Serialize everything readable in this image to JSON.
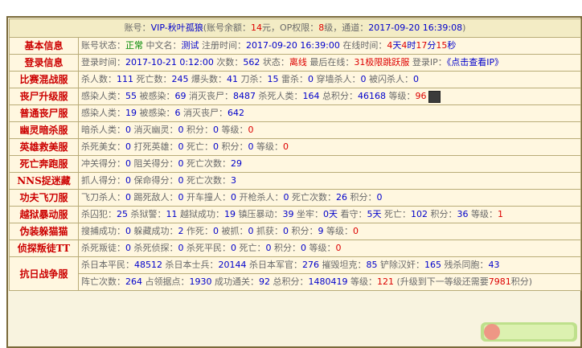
{
  "header": {
    "account_label": "账号：",
    "account_name": "VIP-秋叶孤狼",
    "balance_label": "(账号余额：",
    "balance_value": "14",
    "balance_unit": "元，OP权限：",
    "op_level": "8",
    "op_unit": "级，通道：",
    "channel_time": "2017-09-20 16:39:08",
    "close_paren": ")"
  },
  "rows": [
    {
      "label": "基本信息",
      "line": [
        {
          "t": "账号状态：",
          "c": "gray"
        },
        {
          "t": "正常",
          "c": "green"
        },
        {
          "t": " 中文名：",
          "c": "gray"
        },
        {
          "t": "测试",
          "c": "v"
        },
        {
          "t": " 注册时间：",
          "c": "gray"
        },
        {
          "t": "2017-09-20 16:39:00",
          "c": "v"
        },
        {
          "t": " 在线时间：",
          "c": "gray"
        },
        {
          "t": "4",
          "c": "red"
        },
        {
          "t": "天",
          "c": "v"
        },
        {
          "t": "4",
          "c": "red"
        },
        {
          "t": "时",
          "c": "v"
        },
        {
          "t": "17",
          "c": "red"
        },
        {
          "t": "分",
          "c": "v"
        },
        {
          "t": "15",
          "c": "red"
        },
        {
          "t": "秒",
          "c": "v"
        }
      ]
    },
    {
      "label": "登录信息",
      "line": [
        {
          "t": "登录时间：",
          "c": "gray"
        },
        {
          "t": "2017-10-21 0:12:00",
          "c": "v"
        },
        {
          "t": " 次数：",
          "c": "gray"
        },
        {
          "t": "562",
          "c": "v"
        },
        {
          "t": " 状态：",
          "c": "gray"
        },
        {
          "t": "离线",
          "c": "red"
        },
        {
          "t": " 最后在线：",
          "c": "gray"
        },
        {
          "t": "31极限跳跃服",
          "c": "red"
        },
        {
          "t": " 登录IP：",
          "c": "gray"
        },
        {
          "t": "《点击查看IP》",
          "c": "v"
        }
      ]
    },
    {
      "label": "比赛混战服",
      "line": [
        {
          "t": "杀人数：",
          "c": "gray"
        },
        {
          "t": "111",
          "c": "v"
        },
        {
          "t": " 死亡数：",
          "c": "gray"
        },
        {
          "t": "245",
          "c": "v"
        },
        {
          "t": " 爆头数：",
          "c": "gray"
        },
        {
          "t": "41",
          "c": "v"
        },
        {
          "t": " 刀杀：",
          "c": "gray"
        },
        {
          "t": "15",
          "c": "v"
        },
        {
          "t": " 雷杀：",
          "c": "gray"
        },
        {
          "t": "0",
          "c": "v"
        },
        {
          "t": " 穿墙杀人：",
          "c": "gray"
        },
        {
          "t": "0",
          "c": "v"
        },
        {
          "t": " 被闪杀人：",
          "c": "gray"
        },
        {
          "t": "0",
          "c": "v"
        }
      ]
    },
    {
      "label": "丧尸升级服",
      "avatar": true,
      "line": [
        {
          "t": "感染人类：",
          "c": "gray"
        },
        {
          "t": "55",
          "c": "v"
        },
        {
          "t": " 被感染：",
          "c": "gray"
        },
        {
          "t": "69",
          "c": "v"
        },
        {
          "t": " 消灭丧尸：",
          "c": "gray"
        },
        {
          "t": "8487",
          "c": "v"
        },
        {
          "t": " 杀死人类：",
          "c": "gray"
        },
        {
          "t": "164",
          "c": "v"
        },
        {
          "t": " 总积分：",
          "c": "gray"
        },
        {
          "t": "46168",
          "c": "v"
        },
        {
          "t": " 等级：",
          "c": "gray"
        },
        {
          "t": "96",
          "c": "red"
        }
      ]
    },
    {
      "label": "普通丧尸服",
      "line": [
        {
          "t": "感染人类：",
          "c": "gray"
        },
        {
          "t": "19",
          "c": "v"
        },
        {
          "t": " 被感染：",
          "c": "gray"
        },
        {
          "t": "6",
          "c": "v"
        },
        {
          "t": " 消灭丧尸：",
          "c": "gray"
        },
        {
          "t": "642",
          "c": "v"
        }
      ]
    },
    {
      "label": "幽灵暗杀服",
      "line": [
        {
          "t": "暗杀人类：",
          "c": "gray"
        },
        {
          "t": "0",
          "c": "v"
        },
        {
          "t": " 消灭幽灵：",
          "c": "gray"
        },
        {
          "t": "0",
          "c": "v"
        },
        {
          "t": " 积分：",
          "c": "gray"
        },
        {
          "t": "0",
          "c": "v"
        },
        {
          "t": " 等级：",
          "c": "gray"
        },
        {
          "t": "0",
          "c": "red"
        }
      ]
    },
    {
      "label": "英雄救美服",
      "line": [
        {
          "t": "杀死美女：",
          "c": "gray"
        },
        {
          "t": "0",
          "c": "v"
        },
        {
          "t": " 打死英雄：",
          "c": "gray"
        },
        {
          "t": "0",
          "c": "v"
        },
        {
          "t": " 死亡：",
          "c": "gray"
        },
        {
          "t": "0",
          "c": "v"
        },
        {
          "t": " 积分：",
          "c": "gray"
        },
        {
          "t": "0",
          "c": "v"
        },
        {
          "t": " 等级：",
          "c": "gray"
        },
        {
          "t": "0",
          "c": "red"
        }
      ]
    },
    {
      "label": "死亡奔跑服",
      "line": [
        {
          "t": "冲关得分：",
          "c": "gray"
        },
        {
          "t": "0",
          "c": "v"
        },
        {
          "t": " 阻关得分：",
          "c": "gray"
        },
        {
          "t": "0",
          "c": "v"
        },
        {
          "t": " 死亡次数：",
          "c": "gray"
        },
        {
          "t": "29",
          "c": "v"
        }
      ]
    },
    {
      "label": "NNS捉迷藏",
      "line": [
        {
          "t": "抓人得分：",
          "c": "gray"
        },
        {
          "t": "0",
          "c": "v"
        },
        {
          "t": " 保命得分：",
          "c": "gray"
        },
        {
          "t": "0",
          "c": "v"
        },
        {
          "t": " 死亡次数：",
          "c": "gray"
        },
        {
          "t": "3",
          "c": "v"
        }
      ]
    },
    {
      "label": "功夫飞刀服",
      "line": [
        {
          "t": "飞刀杀人：",
          "c": "gray"
        },
        {
          "t": "0",
          "c": "v"
        },
        {
          "t": " 踢死敌人：",
          "c": "gray"
        },
        {
          "t": "0",
          "c": "v"
        },
        {
          "t": " 开车撞人：",
          "c": "gray"
        },
        {
          "t": "0",
          "c": "v"
        },
        {
          "t": " 开枪杀人：",
          "c": "gray"
        },
        {
          "t": "0",
          "c": "v"
        },
        {
          "t": " 死亡次数：",
          "c": "gray"
        },
        {
          "t": "26",
          "c": "v"
        },
        {
          "t": " 积分：",
          "c": "gray"
        },
        {
          "t": "0",
          "c": "v"
        }
      ]
    },
    {
      "label": "越狱暴动服",
      "line": [
        {
          "t": "杀囚犯：",
          "c": "gray"
        },
        {
          "t": "25",
          "c": "v"
        },
        {
          "t": " 杀狱警：",
          "c": "gray"
        },
        {
          "t": "11",
          "c": "v"
        },
        {
          "t": " 越狱成功：",
          "c": "gray"
        },
        {
          "t": "19",
          "c": "v"
        },
        {
          "t": " 镇压暴动：",
          "c": "gray"
        },
        {
          "t": "39",
          "c": "v"
        },
        {
          "t": " 坐牢：",
          "c": "gray"
        },
        {
          "t": "0天",
          "c": "v"
        },
        {
          "t": " 看守：",
          "c": "gray"
        },
        {
          "t": "5天",
          "c": "v"
        },
        {
          "t": " 死亡：",
          "c": "gray"
        },
        {
          "t": "102",
          "c": "v"
        },
        {
          "t": " 积分：",
          "c": "gray"
        },
        {
          "t": "36",
          "c": "v"
        },
        {
          "t": " 等级：",
          "c": "gray"
        },
        {
          "t": "1",
          "c": "red"
        }
      ]
    },
    {
      "label": "伪装躲猫猫",
      "line": [
        {
          "t": "搜捕成功：",
          "c": "gray"
        },
        {
          "t": "0",
          "c": "v"
        },
        {
          "t": " 躲藏成功：",
          "c": "gray"
        },
        {
          "t": "2",
          "c": "v"
        },
        {
          "t": " 作死：",
          "c": "gray"
        },
        {
          "t": "0",
          "c": "v"
        },
        {
          "t": " 被抓：",
          "c": "gray"
        },
        {
          "t": "0",
          "c": "v"
        },
        {
          "t": " 抓获：",
          "c": "gray"
        },
        {
          "t": "0",
          "c": "v"
        },
        {
          "t": " 积分：",
          "c": "gray"
        },
        {
          "t": "9",
          "c": "v"
        },
        {
          "t": " 等级：",
          "c": "gray"
        },
        {
          "t": "0",
          "c": "red"
        }
      ]
    },
    {
      "label": "侦探叛徒TT",
      "line": [
        {
          "t": "杀死叛徒：",
          "c": "gray"
        },
        {
          "t": "0",
          "c": "v"
        },
        {
          "t": " 杀死侦探：",
          "c": "gray"
        },
        {
          "t": "0",
          "c": "v"
        },
        {
          "t": " 杀死平民：",
          "c": "gray"
        },
        {
          "t": "0",
          "c": "v"
        },
        {
          "t": " 死亡：",
          "c": "gray"
        },
        {
          "t": "0",
          "c": "v"
        },
        {
          "t": " 积分：",
          "c": "gray"
        },
        {
          "t": "0",
          "c": "v"
        },
        {
          "t": " 等级：",
          "c": "gray"
        },
        {
          "t": "0",
          "c": "red"
        }
      ]
    }
  ],
  "war_row": {
    "label": "抗日战争服",
    "line1": [
      {
        "t": "杀日本平民：",
        "c": "gray"
      },
      {
        "t": "48512",
        "c": "v"
      },
      {
        "t": " 杀日本士兵：",
        "c": "gray"
      },
      {
        "t": "20144",
        "c": "v"
      },
      {
        "t": " 杀日本军官：",
        "c": "gray"
      },
      {
        "t": "276",
        "c": "v"
      },
      {
        "t": " 摧毁坦克：",
        "c": "gray"
      },
      {
        "t": "85",
        "c": "v"
      },
      {
        "t": " 铲除汉奸：",
        "c": "gray"
      },
      {
        "t": "165",
        "c": "v"
      },
      {
        "t": " 残杀同胞：",
        "c": "gray"
      },
      {
        "t": "43",
        "c": "v"
      }
    ],
    "line2": [
      {
        "t": "阵亡次数：",
        "c": "gray"
      },
      {
        "t": "264",
        "c": "v"
      },
      {
        "t": " 占领据点：",
        "c": "gray"
      },
      {
        "t": "1930",
        "c": "v"
      },
      {
        "t": " 成功通关：",
        "c": "gray"
      },
      {
        "t": "92",
        "c": "v"
      },
      {
        "t": " 总积分：",
        "c": "gray"
      },
      {
        "t": "1480419",
        "c": "v"
      },
      {
        "t": " 等级：",
        "c": "gray"
      },
      {
        "t": "121",
        "c": "red"
      },
      {
        "t": " (升级到下一等级还需要",
        "c": "gray"
      },
      {
        "t": "7981",
        "c": "red"
      },
      {
        "t": "积分)",
        "c": "gray"
      }
    ]
  },
  "colors": {
    "label_red": "#cc0000",
    "value_blue": "#0000cc",
    "online_green": "#008800"
  },
  "icons": {
    "avatar": "avatar-icon"
  }
}
